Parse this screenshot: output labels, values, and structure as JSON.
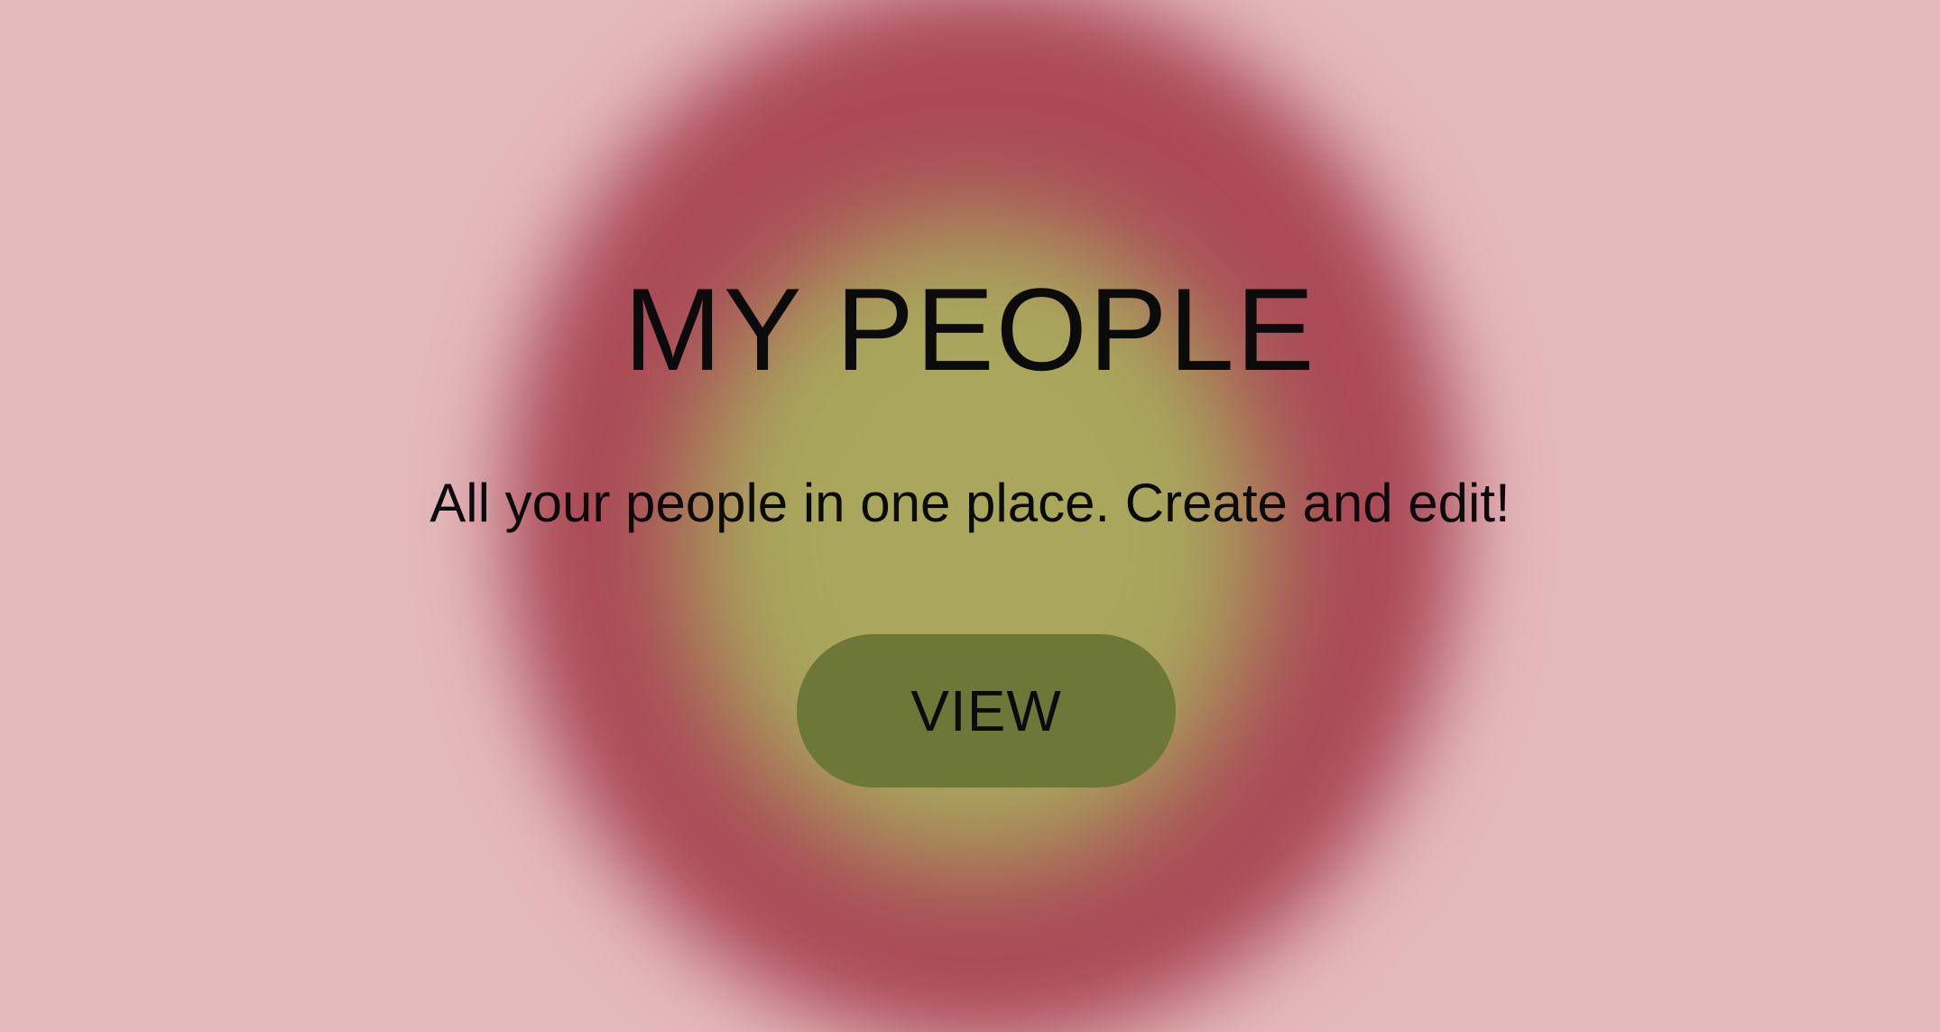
{
  "hero": {
    "title": "MY PEOPLE",
    "subtitle": "All your people in one place. Create and edit!",
    "button_label": "VIEW"
  },
  "colors": {
    "background": "#e4b9bc",
    "outer_glow": "#ab4a58",
    "inner_glow": "#a8a75c",
    "button": "#6d7737",
    "text": "#0c0b0b"
  }
}
